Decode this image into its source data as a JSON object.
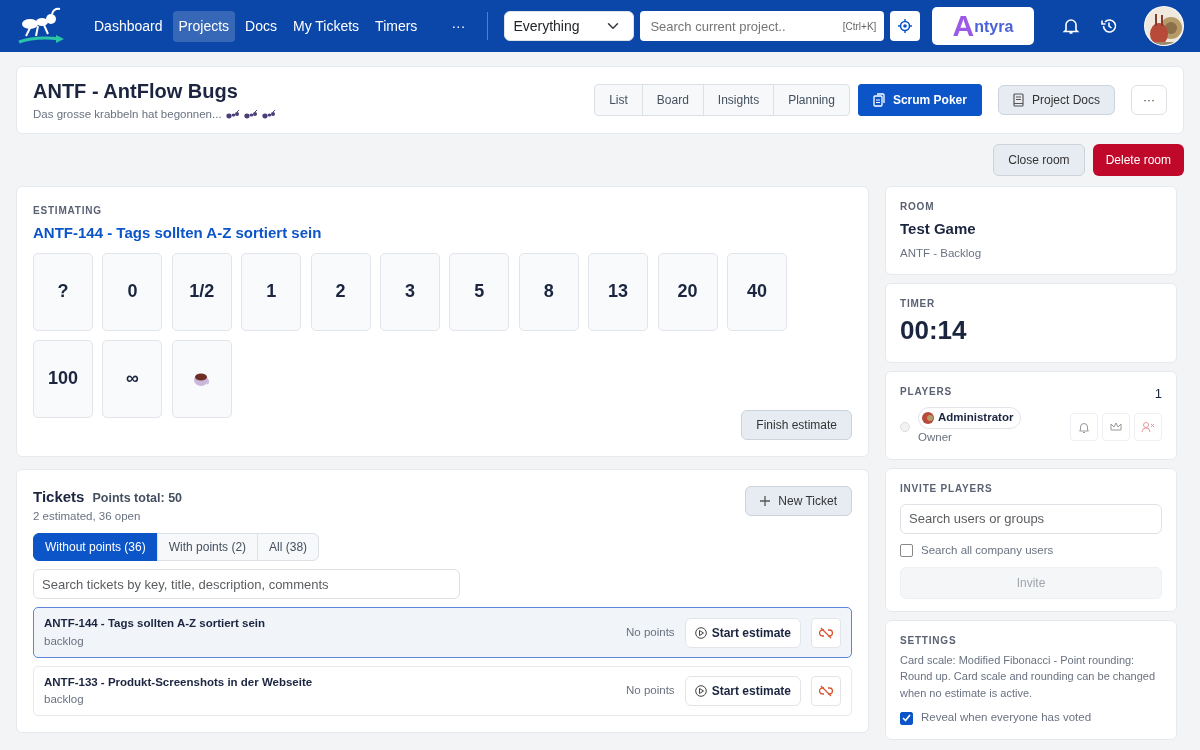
{
  "nav": {
    "links": [
      {
        "label": "Dashboard",
        "selected": false
      },
      {
        "label": "Projects",
        "selected": true
      },
      {
        "label": "Docs",
        "selected": false
      },
      {
        "label": "My Tickets",
        "selected": false
      },
      {
        "label": "Timers",
        "selected": false
      }
    ],
    "more": "···",
    "scope": "Everything",
    "search_placeholder": "Search current project..",
    "shortcut": "[Ctrl+K]",
    "logo_initial": "A",
    "logo_rest": "ntyra"
  },
  "project": {
    "title": "ANTF - AntFlow Bugs",
    "subtitle": "Das grosse krabbeln hat begonnen...",
    "views": [
      {
        "label": "List",
        "selected": false
      },
      {
        "label": "Board",
        "selected": false
      },
      {
        "label": "Insights",
        "selected": false
      },
      {
        "label": "Planning",
        "selected": false
      },
      {
        "label": "Scrum Poker",
        "selected": true
      }
    ],
    "docs_button": "Project Docs",
    "more": "···"
  },
  "room_actions": [
    {
      "label": "Close room",
      "kind": "secondary"
    },
    {
      "label": "Delete room",
      "kind": "danger"
    }
  ],
  "estimating": {
    "label": "ESTIMATING",
    "ticket": "ANTF-144 - Tags sollten A-Z sortiert sein",
    "cards": [
      {
        "kind": "value",
        "label": "?"
      },
      {
        "kind": "value",
        "label": "0"
      },
      {
        "kind": "value",
        "label": "1/2"
      },
      {
        "kind": "value",
        "label": "1"
      },
      {
        "kind": "value",
        "label": "2"
      },
      {
        "kind": "value",
        "label": "3"
      },
      {
        "kind": "value",
        "label": "5"
      },
      {
        "kind": "value",
        "label": "8"
      },
      {
        "kind": "value",
        "label": "13"
      },
      {
        "kind": "value",
        "label": "20"
      },
      {
        "kind": "value",
        "label": "40"
      },
      {
        "kind": "value",
        "label": "100"
      },
      {
        "kind": "value",
        "label": "∞"
      },
      {
        "kind": "coffee"
      }
    ],
    "finish_button": "Finish estimate"
  },
  "tickets": {
    "title": "Tickets",
    "points_total": "Points total: 50",
    "summary": "2 estimated, 36 open",
    "new_button": "New Ticket",
    "filters": [
      {
        "label": "Without points (36)",
        "selected": true
      },
      {
        "label": "With points (2)",
        "selected": false
      },
      {
        "label": "All (38)",
        "selected": false
      }
    ],
    "search_placeholder": "Search tickets by key, title, description, comments",
    "rows": [
      {
        "title": "ANTF-144 - Tags sollten A-Z sortiert sein",
        "status": "backlog",
        "points": "No points",
        "action": "Start estimate",
        "selected": true
      },
      {
        "title": "ANTF-133 - Produkt-Screenshots in der Webseite",
        "status": "backlog",
        "points": "No points",
        "action": "Start estimate",
        "selected": false
      }
    ]
  },
  "room": {
    "label": "ROOM",
    "name": "Test Game",
    "project": "ANTF - Backlog"
  },
  "timer": {
    "label": "TIMER",
    "value": "00:14"
  },
  "players": {
    "label": "PLAYERS",
    "count": "1",
    "list": [
      {
        "name": "Administrator",
        "role": "Owner",
        "online": false
      }
    ]
  },
  "invite": {
    "label": "INVITE PLAYERS",
    "placeholder": "Search users or groups",
    "checkbox": {
      "label": "Search all company users",
      "checked": false
    },
    "button": {
      "label": "Invite",
      "disabled": true
    }
  },
  "settings": {
    "label": "SETTINGS",
    "text": "Card scale: Modified Fibonacci - Point rounding: Round up. Card scale and rounding can be changed when no estimate is active.",
    "checkbox": {
      "label": "Reveal when everyone has voted",
      "checked": true
    }
  }
}
